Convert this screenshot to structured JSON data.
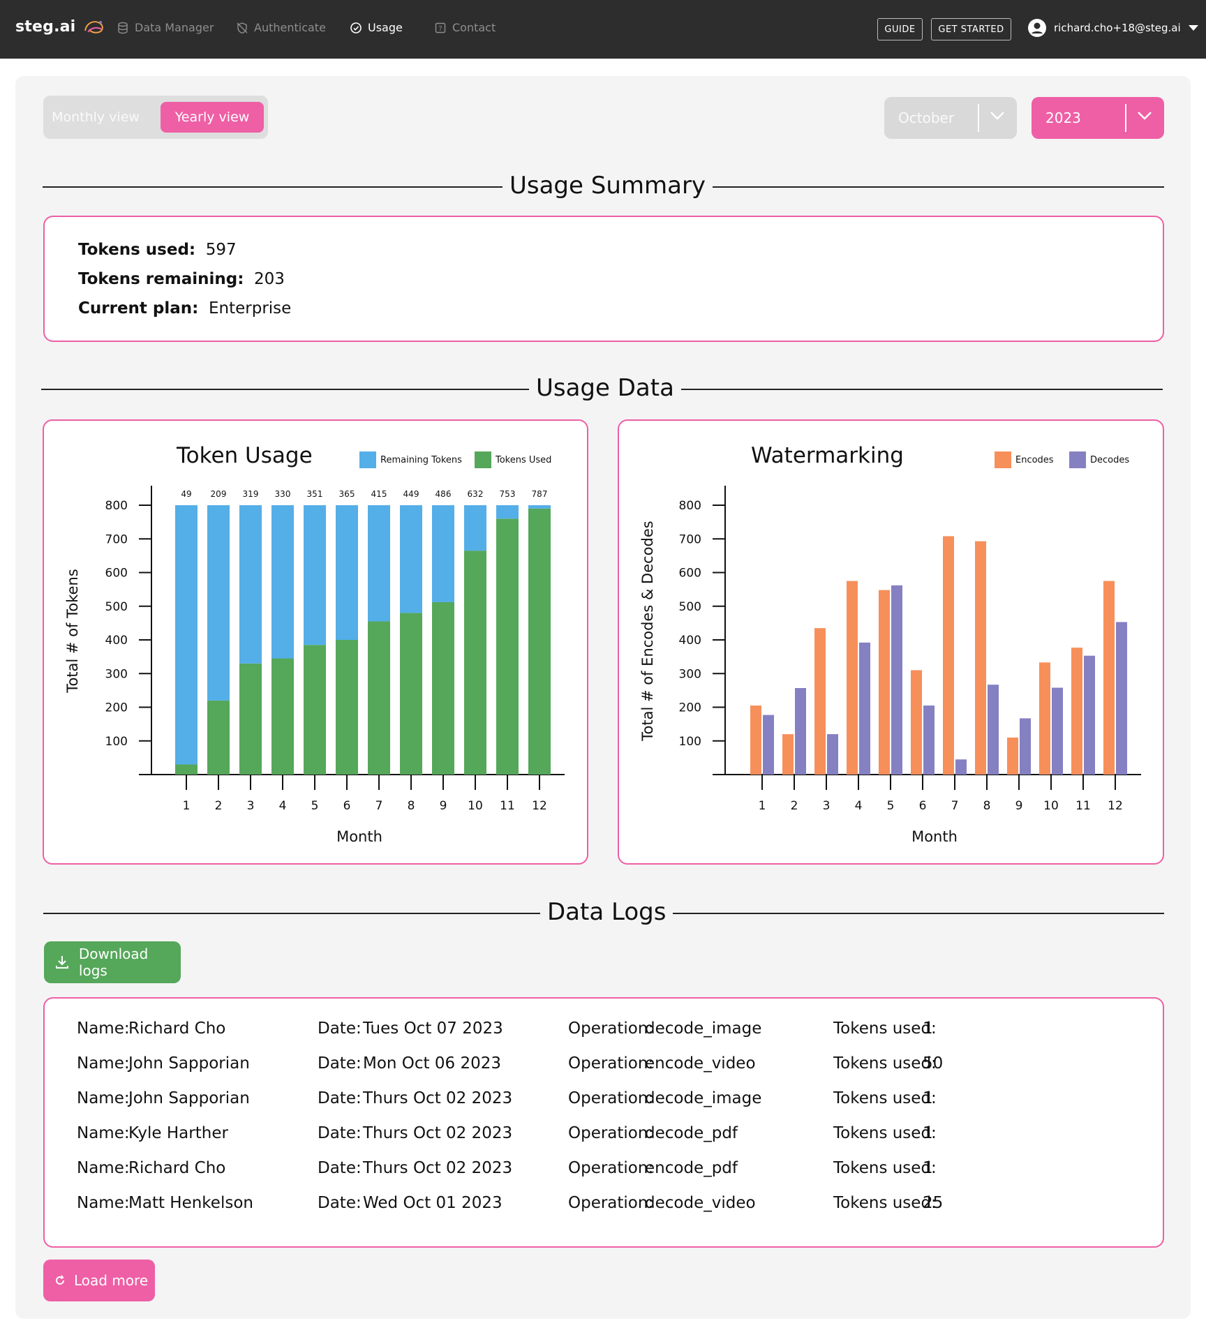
{
  "nav": {
    "brand": "steg.ai",
    "items": [
      {
        "label": "Data Manager",
        "icon": "database-icon"
      },
      {
        "label": "Authenticate",
        "icon": "shield-off-icon"
      },
      {
        "label": "Usage",
        "icon": "gauge-icon"
      },
      {
        "label": "Contact",
        "icon": "help-box-icon"
      }
    ],
    "active": "Usage",
    "guide_label": "GUIDE",
    "get_started_label": "GET STARTED",
    "user_email": "richard.cho+18@steg.ai"
  },
  "controls": {
    "monthly_label": "Monthly view",
    "yearly_label": "Yearly view",
    "selected_view": "Yearly view",
    "month_value": "October",
    "year_value": "2023"
  },
  "summary": {
    "title": "Usage Summary",
    "tokens_used_label": "Tokens used:",
    "tokens_used": "597",
    "tokens_remaining_label": "Tokens remaining:",
    "tokens_remaining": "203",
    "plan_label": "Current plan:",
    "plan": "Enterprise"
  },
  "usage_data_title": "Usage Data",
  "chart_data": [
    {
      "type": "bar",
      "stacked": true,
      "title": "Token Usage",
      "xlabel": "Month",
      "ylabel": "Total # of Tokens",
      "categories": [
        "1",
        "2",
        "3",
        "4",
        "5",
        "6",
        "7",
        "8",
        "9",
        "10",
        "11",
        "12"
      ],
      "data_labels": [
        "49",
        "209",
        "319",
        "330",
        "351",
        "365",
        "415",
        "449",
        "486",
        "632",
        "753",
        "787"
      ],
      "yticks": [
        100,
        200,
        300,
        400,
        500,
        600,
        700,
        800
      ],
      "ylim": [
        0,
        880
      ],
      "series": [
        {
          "name": "Tokens Used",
          "color": "#55a75a",
          "values": [
            30,
            220,
            330,
            345,
            385,
            400,
            455,
            480,
            512,
            665,
            760,
            790
          ]
        },
        {
          "name": "Remaining Tokens",
          "color": "#54aee8",
          "values": [
            770,
            580,
            470,
            455,
            415,
            400,
            345,
            320,
            288,
            135,
            40,
            10
          ]
        }
      ],
      "legend": "top-right"
    },
    {
      "type": "bar",
      "title": "Watermarking",
      "xlabel": "Month",
      "ylabel": "Total # of Encodes & Decodes",
      "categories": [
        "1",
        "2",
        "3",
        "4",
        "5",
        "6",
        "7",
        "8",
        "9",
        "10",
        "11",
        "12"
      ],
      "yticks": [
        100,
        200,
        300,
        400,
        500,
        600,
        700,
        800
      ],
      "ylim": [
        0,
        880
      ],
      "series": [
        {
          "name": "Encodes",
          "color": "#f78f5a",
          "values": [
            205,
            120,
            435,
            575,
            548,
            310,
            708,
            693,
            110,
            333,
            377,
            575
          ]
        },
        {
          "name": "Decodes",
          "color": "#8580c2",
          "values": [
            177,
            257,
            120,
            392,
            562,
            205,
            45,
            267,
            167,
            258,
            353,
            453
          ]
        }
      ],
      "legend": "top-right"
    }
  ],
  "logs": {
    "title": "Data Logs",
    "download_label": "Download logs",
    "load_more_label": "Load more",
    "name_label": "Name:",
    "date_label": "Date:",
    "operation_label": "Operation:",
    "tokens_label": "Tokens used:",
    "rows": [
      {
        "name": "Richard Cho",
        "date": "Tues Oct 07 2023",
        "operation": "decode_image",
        "tokens": "1"
      },
      {
        "name": "John Sapporian",
        "date": "Mon Oct 06 2023",
        "operation": "encode_video",
        "tokens": "50"
      },
      {
        "name": "John Sapporian",
        "date": "Thurs Oct 02 2023",
        "operation": "decode_image",
        "tokens": "1"
      },
      {
        "name": "Kyle Harther",
        "date": "Thurs Oct 02 2023",
        "operation": "decode_pdf",
        "tokens": "1"
      },
      {
        "name": "Richard Cho",
        "date": "Thurs Oct 02 2023",
        "operation": "encode_pdf",
        "tokens": "1"
      },
      {
        "name": "Matt Henkelson",
        "date": "Wed Oct 01 2023",
        "operation": "decode_video",
        "tokens": "25"
      }
    ]
  }
}
